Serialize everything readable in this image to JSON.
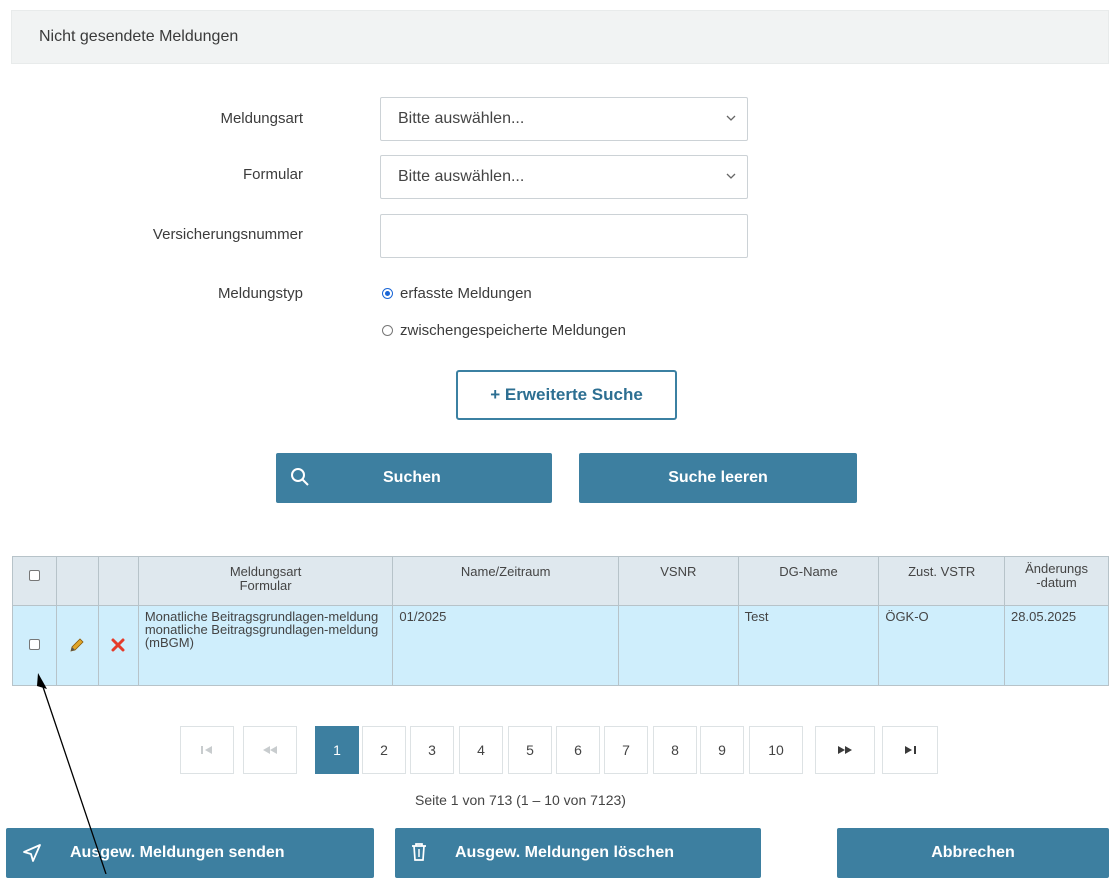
{
  "header": {
    "title": "Nicht gesendete Meldungen"
  },
  "form": {
    "meldungsart": {
      "label": "Meldungsart",
      "value": "Bitte auswählen..."
    },
    "formular": {
      "label": "Formular",
      "value": "Bitte auswählen..."
    },
    "versicherungsnummer": {
      "label": "Versicherungsnummer",
      "value": ""
    },
    "meldungstyp": {
      "label": "Meldungstyp",
      "options": [
        {
          "label": "erfasste Meldungen",
          "selected": true
        },
        {
          "label": "zwischengespeicherte Meldungen",
          "selected": false
        }
      ]
    }
  },
  "buttons": {
    "extended_search": "+ Erweiterte Suche",
    "search": "Suchen",
    "clear_search": "Suche leeren",
    "send_selected": "Ausgew. Meldungen senden",
    "delete_selected": "Ausgew. Meldungen löschen",
    "cancel": "Abbrechen"
  },
  "table": {
    "headers": {
      "meldungsart": "Meldungsart",
      "formular": "Formular",
      "name_zeitraum": "Name/Zeitraum",
      "vsnr": "VSNR",
      "dg_name": "DG-Name",
      "zust_vstr": "Zust. VSTR",
      "aenderung_1": "Änderungs",
      "aenderung_2": "-datum"
    },
    "rows": [
      {
        "meldungsart": "Monatliche Beitragsgrundlagen-meldung",
        "formular": "monatliche Beitragsgrundlagen-meldung (mBGM)",
        "name_zeitraum": "01/2025",
        "vsnr": "",
        "dg_name": "Test",
        "zust_vstr": "ÖGK-O",
        "aenderungsdatum": "28.05.2025"
      }
    ]
  },
  "pagination": {
    "pages": [
      "1",
      "2",
      "3",
      "4",
      "5",
      "6",
      "7",
      "8",
      "9",
      "10"
    ],
    "current_page": 1,
    "info": "Seite 1 von 713 (1 – 10 von 7123)"
  },
  "icons": {
    "first": "first-page-icon",
    "prev": "previous-page-icon",
    "next": "next-page-icon",
    "last": "last-page-icon",
    "search": "search-icon",
    "send": "send-icon",
    "delete": "trash-icon",
    "edit": "pencil-icon",
    "remove": "delete-x-icon"
  },
  "colors": {
    "primary": "#3d7fa0",
    "row_highlight": "#cfeefc",
    "header_bg": "#dfe8ee"
  }
}
